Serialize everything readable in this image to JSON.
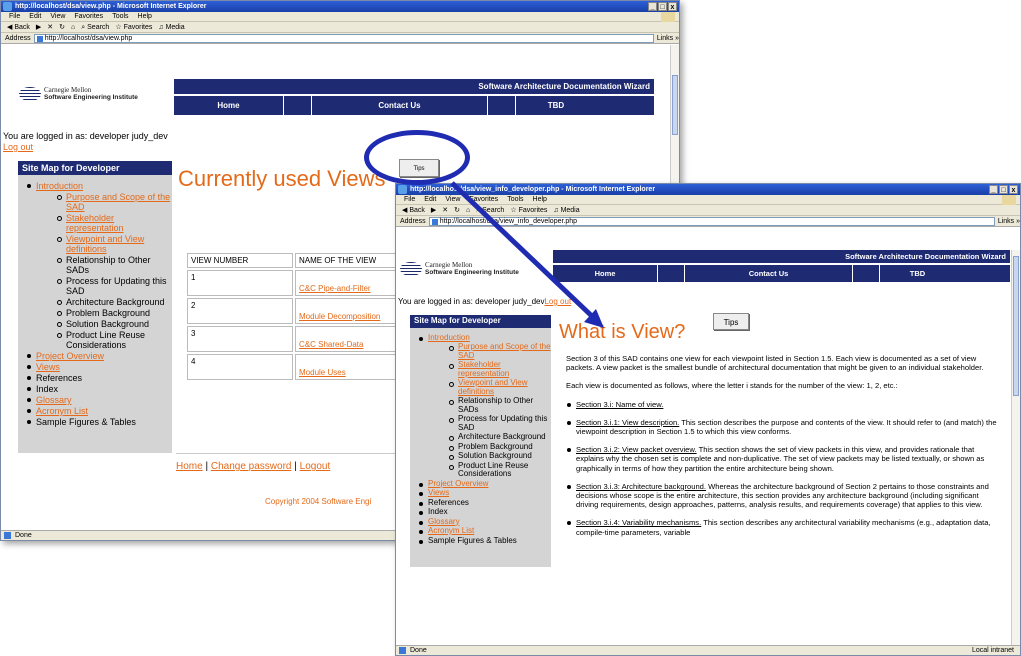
{
  "browser": {
    "menu": [
      "File",
      "Edit",
      "View",
      "Favorites",
      "Tools",
      "Help"
    ],
    "toolbar": {
      "back": "Back",
      "search": "Search",
      "favorites": "Favorites",
      "media": "Media"
    },
    "address_label": "Address",
    "links_label": "Links »",
    "controls": [
      "_",
      "□",
      "x"
    ]
  },
  "win1": {
    "title": "http://localhost/dsa/view.php - Microsoft Internet Explorer",
    "url": "http://localhost/dsa/view.php",
    "status": "Done"
  },
  "win2": {
    "title": "http://localhost/dsa/view_info_developer.php - Microsoft Internet Explorer",
    "url": "http://localhost/dsa/view_info_developer.php",
    "status": "Done",
    "zone": "Local intranet"
  },
  "site": {
    "logo_line1": "Carnegie Mellon",
    "logo_line2": "Software Engineering Institute",
    "banner": "Software Architecture Documentation Wizard",
    "nav": [
      "Home",
      "Contact Us",
      "TBD"
    ],
    "logged_in": "You are logged in as: developer judy_dev",
    "logout": "Log out",
    "sitemap_title": "Site Map for Developer",
    "sitemap": [
      {
        "label": "Introduction",
        "level": 1,
        "link": true
      },
      {
        "label": "Purpose and Scope of the SAD",
        "level": 2,
        "link": true
      },
      {
        "label": "Stakeholder representation",
        "level": 2,
        "link": true
      },
      {
        "label": "Viewpoint and View definitions",
        "level": 2,
        "link": true
      },
      {
        "label": "Relationship to Other SADs",
        "level": 2,
        "link": false
      },
      {
        "label": "Process for Updating this SAD",
        "level": 2,
        "link": false
      },
      {
        "label": "Architecture Background",
        "level": 2,
        "link": false
      },
      {
        "label": "Problem Background",
        "level": 2,
        "link": false
      },
      {
        "label": "Solution Background",
        "level": 2,
        "link": false
      },
      {
        "label": "Product Line Reuse Considerations",
        "level": 2,
        "link": false
      },
      {
        "label": "Project Overview",
        "level": 1,
        "link": true
      },
      {
        "label": "Views",
        "level": 1,
        "link": true
      },
      {
        "label": "References",
        "level": 1,
        "link": false
      },
      {
        "label": "Index",
        "level": 1,
        "link": false
      },
      {
        "label": "Glossary",
        "level": 1,
        "link": true
      },
      {
        "label": "Acronym List",
        "level": 1,
        "link": true
      },
      {
        "label": "Sample Figures & Tables",
        "level": 1,
        "link": false
      }
    ]
  },
  "page1": {
    "heading": "Currently used Views",
    "tips": "Tips",
    "table_headers": [
      "VIEW NUMBER",
      "NAME OF THE VIEW"
    ],
    "rows": [
      {
        "num": "1",
        "name": "C&C Pipe-and-Filter"
      },
      {
        "num": "2",
        "name": "Module Decomposition"
      },
      {
        "num": "3",
        "name": "C&C Shared-Data"
      },
      {
        "num": "4",
        "name": "Module Uses"
      }
    ],
    "footer_links": [
      "Home",
      "Change password",
      "Logout"
    ],
    "footer_sep": "|",
    "copyright": "Copyright 2004 Software Engi"
  },
  "page2": {
    "heading": "What is View?",
    "tips": "Tips",
    "p1": "Section 3 of this SAD contains one view for each viewpoint listed in Section 1.5. Each view is documented as a set of view packets. A view packet is the smallest bundle of architectural documentation that might be given to an individual stakeholder.",
    "p2": "Each view is documented as follows, where the letter i stands for the number of the view: 1, 2, etc.:",
    "items": [
      {
        "head": "Section 3.i: Name of view.",
        "body": ""
      },
      {
        "head": "Section 3.i.1: View description.",
        "body": " This section describes the purpose and contents of the view. It should refer to (and match) the viewpoint description in Section 1.5 to which this view conforms."
      },
      {
        "head": "Section 3.i.2: View packet overview.",
        "body": " This section shows the set of view packets in this view, and provides rationale that explains why the chosen set is complete and non-duplicative. The set of view packets may be listed textually, or shown as graphically in terms of how they partition the entire architecture being shown."
      },
      {
        "head": "Section 3.i.3: Architecture background.",
        "body": " Whereas the architecture background of Section 2 pertains to those constraints and decisions whose scope is the entire architecture, this section provides any architecture background (including significant driving requirements, design approaches, patterns, analysis results, and requirements coverage) that applies to this view."
      },
      {
        "head": "Section 3.i.4: Variability mechanisms.",
        "body": " This section describes any architectural variability mechanisms (e.g., adaptation data, compile-time parameters, variable"
      }
    ]
  },
  "colors": {
    "navy": "#1e2a72",
    "link": "#e46a1a",
    "annotation": "#1f2bb0",
    "heading": "#e46a1a"
  }
}
